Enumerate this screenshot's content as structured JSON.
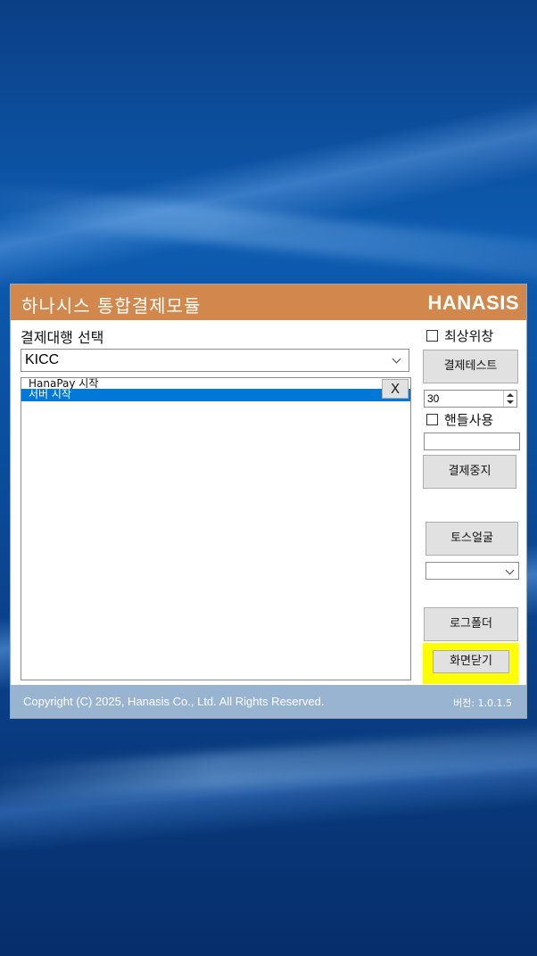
{
  "window": {
    "title": "하나시스 통합결제모듈",
    "brand": "HANASIS"
  },
  "main": {
    "vendor_label": "결제대행 선택",
    "vendor_selected": "KICC",
    "log_items": [
      "HanaPay 시작",
      "서버 시작"
    ],
    "log_close": "X"
  },
  "side": {
    "always_on_top_label": "최상위창",
    "always_on_top_checked": false,
    "pay_test_button": "결제테스트",
    "spin_value": "30",
    "handle_use_label": "핸들사용",
    "handle_use_checked": false,
    "handle_value": "",
    "pay_stop_button": "결제중지",
    "toss_face_button": "토스얼굴",
    "toss_face_selected": "",
    "log_folder_button": "로그폴더",
    "close_screen_button": "화면닫기"
  },
  "footer": {
    "copyright": "Copyright (C) 2025, Hanasis Co., Ltd. All Rights Reserved.",
    "version": "버전: 1.0.1.5"
  },
  "colors": {
    "titlebar": "#d2884c",
    "footer": "#99b4d1",
    "selection": "#0078d7",
    "highlight": "#ffff00"
  }
}
